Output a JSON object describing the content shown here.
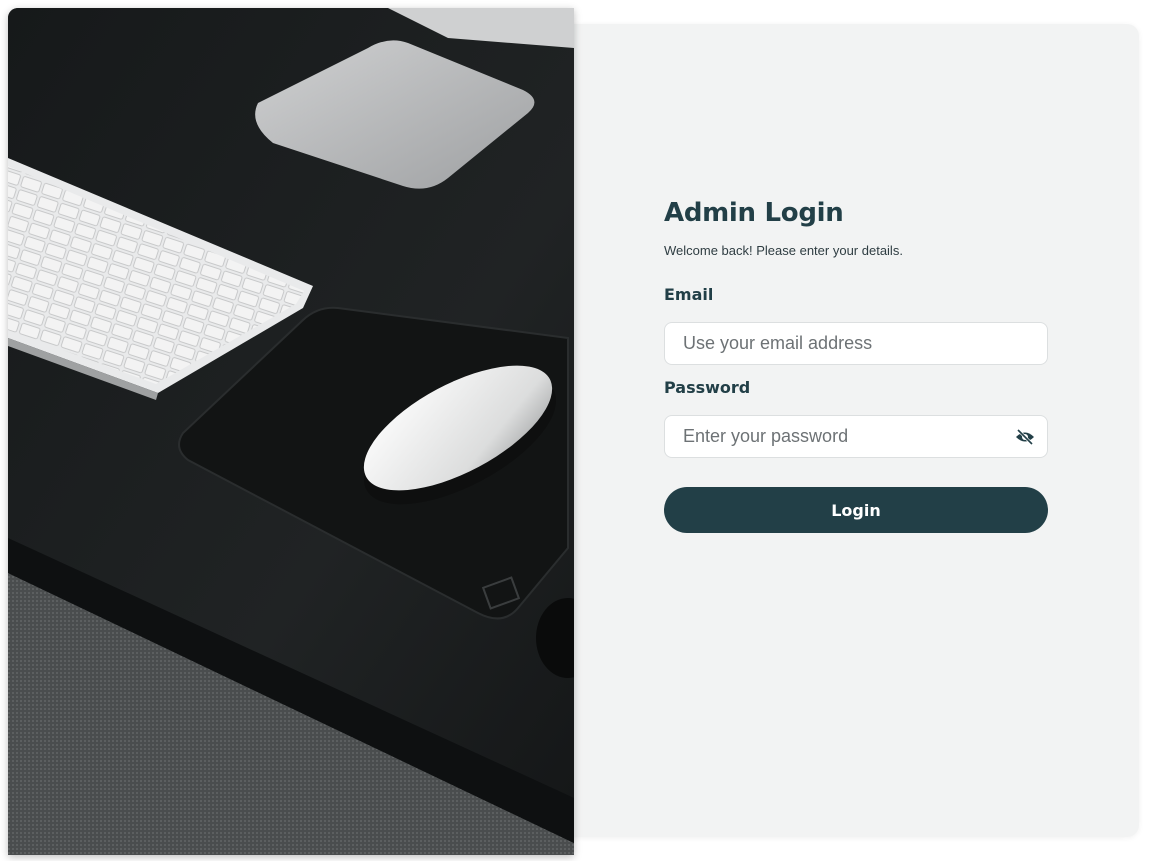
{
  "login": {
    "title": "Admin Login",
    "subtitle": "Welcome back! Please enter your details.",
    "email_label": "Email",
    "email_placeholder": "Use your email address",
    "email_value": "",
    "password_label": "Password",
    "password_placeholder": "Enter your password",
    "password_value": "",
    "password_toggle_icon": "eye-off-icon",
    "submit_label": "Login"
  },
  "colors": {
    "accent": "#223f47",
    "card_bg": "#f2f3f3"
  },
  "hero_image": {
    "icon": "desk-photo-keyboard-mouse"
  }
}
